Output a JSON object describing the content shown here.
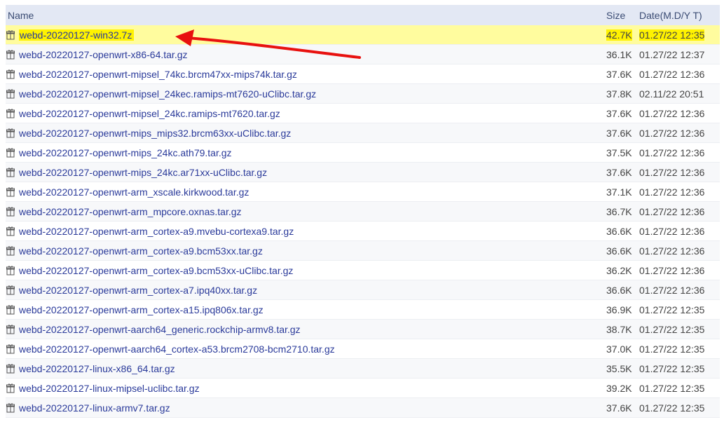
{
  "columns": {
    "name": "Name",
    "size": "Size",
    "date": "Date(M.D/Y T)"
  },
  "files": [
    {
      "name": "webd-20220127-win32.7z",
      "size": "42.7K",
      "date": "01.27/22 12:35",
      "highlighted": true
    },
    {
      "name": "webd-20220127-openwrt-x86-64.tar.gz",
      "size": "36.1K",
      "date": "01.27/22 12:37"
    },
    {
      "name": "webd-20220127-openwrt-mipsel_74kc.brcm47xx-mips74k.tar.gz",
      "size": "37.6K",
      "date": "01.27/22 12:36"
    },
    {
      "name": "webd-20220127-openwrt-mipsel_24kec.ramips-mt7620-uClibc.tar.gz",
      "size": "37.8K",
      "date": "02.11/22 20:51"
    },
    {
      "name": "webd-20220127-openwrt-mipsel_24kc.ramips-mt7620.tar.gz",
      "size": "37.6K",
      "date": "01.27/22 12:36"
    },
    {
      "name": "webd-20220127-openwrt-mips_mips32.brcm63xx-uClibc.tar.gz",
      "size": "37.6K",
      "date": "01.27/22 12:36"
    },
    {
      "name": "webd-20220127-openwrt-mips_24kc.ath79.tar.gz",
      "size": "37.5K",
      "date": "01.27/22 12:36"
    },
    {
      "name": "webd-20220127-openwrt-mips_24kc.ar71xx-uClibc.tar.gz",
      "size": "37.6K",
      "date": "01.27/22 12:36"
    },
    {
      "name": "webd-20220127-openwrt-arm_xscale.kirkwood.tar.gz",
      "size": "37.1K",
      "date": "01.27/22 12:36"
    },
    {
      "name": "webd-20220127-openwrt-arm_mpcore.oxnas.tar.gz",
      "size": "36.7K",
      "date": "01.27/22 12:36"
    },
    {
      "name": "webd-20220127-openwrt-arm_cortex-a9.mvebu-cortexa9.tar.gz",
      "size": "36.6K",
      "date": "01.27/22 12:36"
    },
    {
      "name": "webd-20220127-openwrt-arm_cortex-a9.bcm53xx.tar.gz",
      "size": "36.6K",
      "date": "01.27/22 12:36"
    },
    {
      "name": "webd-20220127-openwrt-arm_cortex-a9.bcm53xx-uClibc.tar.gz",
      "size": "36.2K",
      "date": "01.27/22 12:36"
    },
    {
      "name": "webd-20220127-openwrt-arm_cortex-a7.ipq40xx.tar.gz",
      "size": "36.6K",
      "date": "01.27/22 12:36"
    },
    {
      "name": "webd-20220127-openwrt-arm_cortex-a15.ipq806x.tar.gz",
      "size": "36.9K",
      "date": "01.27/22 12:35"
    },
    {
      "name": "webd-20220127-openwrt-aarch64_generic.rockchip-armv8.tar.gz",
      "size": "38.7K",
      "date": "01.27/22 12:35"
    },
    {
      "name": "webd-20220127-openwrt-aarch64_cortex-a53.brcm2708-bcm2710.tar.gz",
      "size": "37.0K",
      "date": "01.27/22 12:35"
    },
    {
      "name": "webd-20220127-linux-x86_64.tar.gz",
      "size": "35.5K",
      "date": "01.27/22 12:35"
    },
    {
      "name": "webd-20220127-linux-mipsel-uclibc.tar.gz",
      "size": "39.2K",
      "date": "01.27/22 12:35"
    },
    {
      "name": "webd-20220127-linux-armv7.tar.gz",
      "size": "37.6K",
      "date": "01.27/22 12:35"
    }
  ],
  "icons": {
    "file": "archive-file-icon"
  },
  "colors": {
    "header_bg": "#e3e8f4",
    "link": "#2a3a9a",
    "highlight": "#fff200",
    "row_highlight": "#fffc9e",
    "annotation_arrow": "#e8110f"
  }
}
